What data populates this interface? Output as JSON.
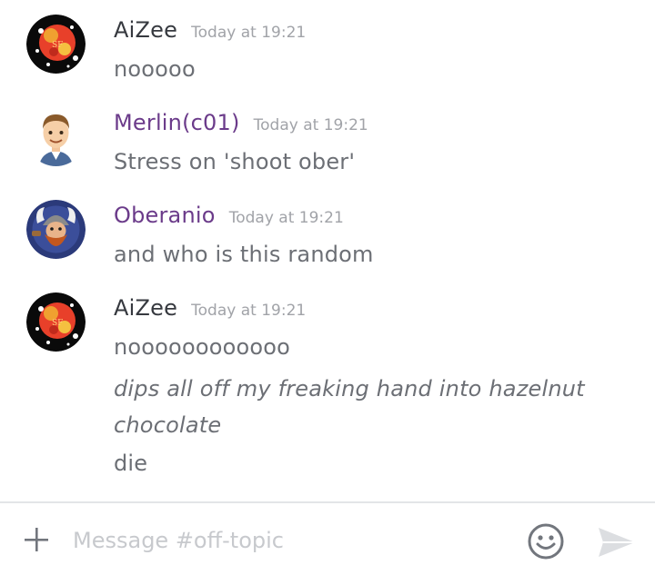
{
  "channel": {
    "input_placeholder": "Message #off-topic",
    "input_value": ""
  },
  "messages": [
    {
      "author": "AiZee",
      "author_color": "#36393f",
      "timestamp": "Today at 19:21",
      "avatar_icon": "planet-avatar-icon",
      "lines": [
        "nooooo"
      ]
    },
    {
      "author": "Merlin(c01)",
      "author_color": "#6b3b8a",
      "timestamp": "Today at 19:21",
      "avatar_icon": "cartoon-man-avatar-icon",
      "lines": [
        "Stress on 'shoot ober'"
      ]
    },
    {
      "author": "Oberanio",
      "author_color": "#6b3b8a",
      "timestamp": "Today at 19:21",
      "avatar_icon": "viking-avatar-icon",
      "lines": [
        "and who is this random"
      ]
    },
    {
      "author": "AiZee",
      "author_color": "#36393f",
      "timestamp": "Today at 19:21",
      "avatar_icon": "planet-avatar-icon",
      "lines": [
        "noooooooooooo",
        "dips all off my freaking hand into hazelnut",
        "chocolate",
        "die"
      ]
    }
  ],
  "icons": {
    "add": "plus-icon",
    "emoji": "emoji-icon",
    "send": "send-icon"
  }
}
